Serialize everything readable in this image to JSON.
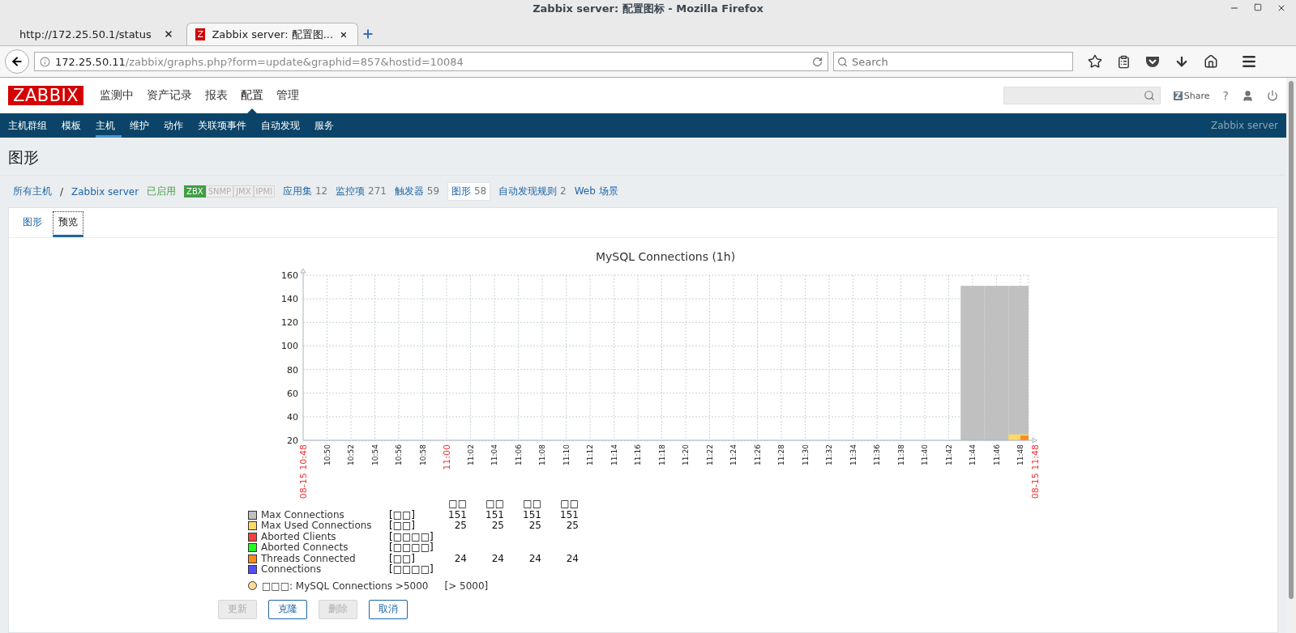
{
  "window": {
    "title": "Zabbix server: 配置图标 - Mozilla Firefox"
  },
  "browser_tabs": [
    {
      "label": "http://172.25.50.1/status",
      "selected": false
    },
    {
      "label": "Zabbix server: 配置图...",
      "selected": true,
      "favicon": "Z"
    }
  ],
  "address_bar": {
    "host": "172.25.50.11",
    "path": "/zabbix/graphs.php?form=update&graphid=857&hostid=10084"
  },
  "browser_search": {
    "placeholder": "Search"
  },
  "header": {
    "logo": "ZABBIX",
    "menu": [
      {
        "label": "监测中",
        "selected": false
      },
      {
        "label": "资产记录",
        "selected": false
      },
      {
        "label": "报表",
        "selected": false
      },
      {
        "label": "配置",
        "selected": true
      },
      {
        "label": "管理",
        "selected": false
      }
    ],
    "share": {
      "logo": "Z",
      "label": "Share"
    },
    "help": "?"
  },
  "submenu": {
    "items": [
      {
        "label": "主机群组",
        "selected": false
      },
      {
        "label": "模板",
        "selected": false
      },
      {
        "label": "主机",
        "selected": true
      },
      {
        "label": "维护",
        "selected": false
      },
      {
        "label": "动作",
        "selected": false
      },
      {
        "label": "关联项事件",
        "selected": false
      },
      {
        "label": "自动发现",
        "selected": false
      },
      {
        "label": "服务",
        "selected": false
      }
    ],
    "server": "Zabbix server"
  },
  "page_title": "图形",
  "host_nav": {
    "all_hosts": "所有主机",
    "separator": "/",
    "host": "Zabbix server",
    "status": "已启用",
    "interfaces": [
      {
        "label": "ZBX",
        "on": true
      },
      {
        "label": "SNMP",
        "on": false
      },
      {
        "label": "JMX",
        "on": false
      },
      {
        "label": "IPMI",
        "on": false
      }
    ],
    "links": [
      {
        "label": "应用集",
        "count": "12",
        "selected": false
      },
      {
        "label": "监控项",
        "count": "271",
        "selected": false
      },
      {
        "label": "触发器",
        "count": "59",
        "selected": false
      },
      {
        "label": "图形",
        "count": "58",
        "selected": true
      },
      {
        "label": "自动发现规则",
        "count": "2",
        "selected": false
      },
      {
        "label": "Web 场景",
        "selected": false
      }
    ]
  },
  "form_tabs": [
    {
      "label": "图形",
      "selected": false
    },
    {
      "label": "预览",
      "selected": true
    }
  ],
  "graph": {
    "chart_data": {
      "type": "bar",
      "title": "MySQL Connections (1h)",
      "grid": true,
      "stacked": false,
      "x": [
        "10:50",
        "10:52",
        "10:54",
        "10:56",
        "10:58",
        "11:02",
        "11:04",
        "11:06",
        "11:08",
        "11:10",
        "11:12",
        "11:14",
        "11:16",
        "11:18",
        "11:20",
        "11:22",
        "11:24",
        "11:26",
        "11:28",
        "11:30",
        "11:32",
        "11:34",
        "11:36",
        "11:38",
        "11:40",
        "11:42",
        "11:44",
        "11:46",
        "11:48"
      ],
      "series": [
        {
          "name": "Max Connections",
          "color": "#c0c0c0",
          "values": [
            null,
            null,
            null,
            null,
            null,
            null,
            null,
            null,
            null,
            null,
            null,
            null,
            null,
            null,
            null,
            null,
            null,
            null,
            null,
            null,
            null,
            null,
            null,
            null,
            null,
            null,
            151,
            151,
            151
          ]
        },
        {
          "name": "Max Used Connections",
          "color": "#ffd966",
          "values": [
            null,
            null,
            null,
            null,
            null,
            null,
            null,
            null,
            null,
            null,
            null,
            null,
            null,
            null,
            null,
            null,
            null,
            null,
            null,
            null,
            null,
            null,
            null,
            null,
            null,
            null,
            null,
            null,
            25
          ]
        },
        {
          "name": "Aborted Clients",
          "color": "#ff4040",
          "values": [
            null,
            null,
            null,
            null,
            null,
            null,
            null,
            null,
            null,
            null,
            null,
            null,
            null,
            null,
            null,
            null,
            null,
            null,
            null,
            null,
            null,
            null,
            null,
            null,
            null,
            null,
            null,
            null,
            null
          ]
        },
        {
          "name": "Aborted Connects",
          "color": "#20ff20",
          "values": [
            null,
            null,
            null,
            null,
            null,
            null,
            null,
            null,
            null,
            null,
            null,
            null,
            null,
            null,
            null,
            null,
            null,
            null,
            null,
            null,
            null,
            null,
            null,
            null,
            null,
            null,
            null,
            null,
            null
          ]
        },
        {
          "name": "Threads Connected",
          "color": "#ff8c1a",
          "values": [
            null,
            null,
            null,
            null,
            null,
            null,
            null,
            null,
            null,
            null,
            null,
            null,
            null,
            null,
            null,
            null,
            null,
            null,
            null,
            null,
            null,
            null,
            null,
            null,
            null,
            null,
            null,
            null,
            24
          ]
        },
        {
          "name": "Connections",
          "color": "#5050ff",
          "values": [
            null,
            null,
            null,
            null,
            null,
            null,
            null,
            null,
            null,
            null,
            null,
            null,
            null,
            null,
            null,
            null,
            null,
            null,
            null,
            null,
            null,
            null,
            null,
            null,
            null,
            null,
            null,
            null,
            null
          ]
        }
      ],
      "ylim": [
        20,
        160
      ],
      "yticks": [
        20,
        40,
        60,
        80,
        100,
        120,
        140,
        160
      ]
    },
    "time_marks": [
      {
        "kind": "start",
        "label": "08-15 10:48"
      },
      {
        "kind": "hour",
        "label": "11:00"
      },
      {
        "kind": "end",
        "label": "08-15 11:48"
      }
    ],
    "legend_header": [
      "□□",
      "□□",
      "□□",
      "□□"
    ],
    "legend": [
      {
        "func": "[□□]",
        "values": [
          "151",
          "151",
          "151",
          "151"
        ]
      },
      {
        "func": "[□□]",
        "values": [
          "25",
          "25",
          "25",
          "25"
        ]
      },
      {
        "func": "[□□□□]"
      },
      {
        "func": "[□□□□]"
      },
      {
        "func": "[□□]",
        "values": [
          "24",
          "24",
          "24",
          "24"
        ]
      },
      {
        "func": "[□□□□]"
      }
    ],
    "trigger": {
      "label": "□□□: MySQL Connections >5000",
      "condition": "[> 5000]"
    }
  },
  "buttons": [
    {
      "label": "更新",
      "disabled": true
    },
    {
      "label": "克隆",
      "disabled": false
    },
    {
      "label": "删除",
      "disabled": true
    },
    {
      "label": "取消",
      "disabled": false
    }
  ]
}
